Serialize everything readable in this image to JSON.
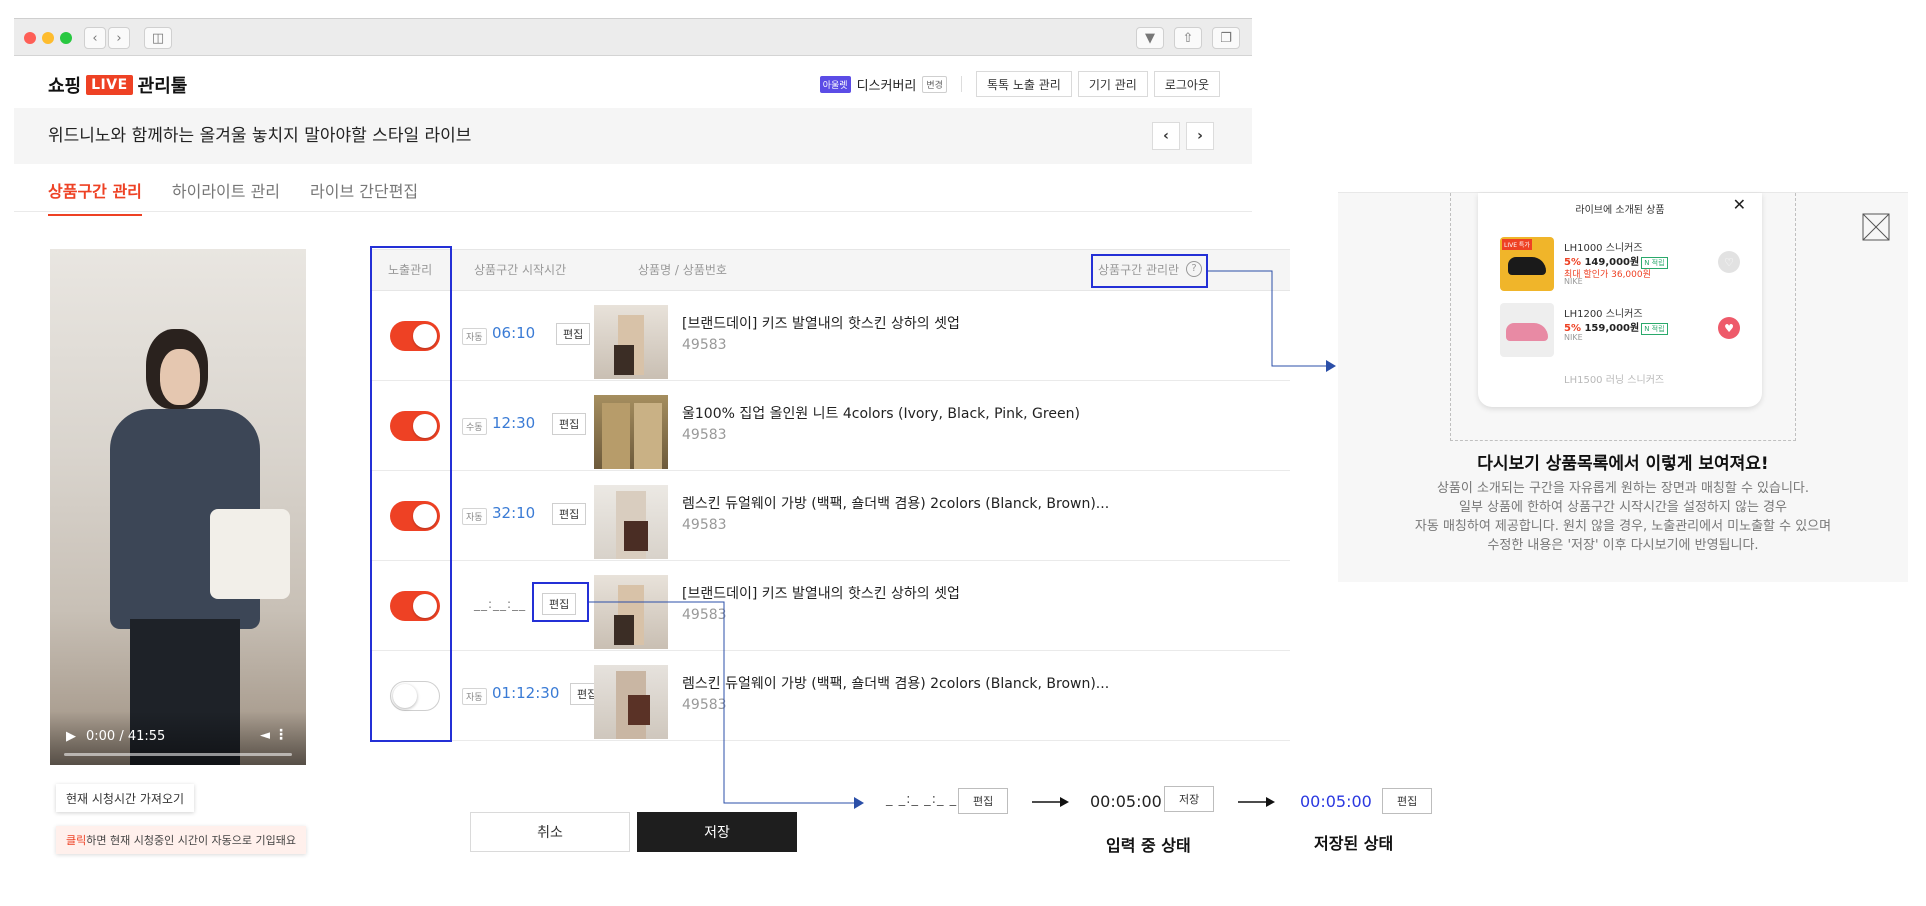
{
  "header": {
    "logo_text": "쇼핑",
    "logo_live": "LIVE",
    "logo_suffix": "관리툴",
    "app_tag": "아울렛",
    "account_name": "디스커버리",
    "change_label": "변경",
    "nav_buttons": [
      "톡톡 노출 관리",
      "기기 관리",
      "로그아웃"
    ]
  },
  "live_title": "위드니노와 함께하는 올겨울 놓치지 말아야할 스타일 라이브",
  "tabs": [
    {
      "label": "상품구간 관리",
      "active": true
    },
    {
      "label": "하이라이트 관리",
      "active": false
    },
    {
      "label": "라이브 간단편집",
      "active": false
    }
  ],
  "video": {
    "time": "0:00 / 41:55",
    "fetch_current_time_label": "현재 시청시간 가져오기",
    "tooltip_highlight": "클릭",
    "tooltip_text": "하면 현재 시청중인 시간이 자동으로 기입돼요"
  },
  "table": {
    "headers": {
      "exposure": "노출관리",
      "start_time": "상품구간 시작시간",
      "product": "상품명 / 상품번호",
      "management": "상품구간 관리란"
    },
    "rows": [
      {
        "exposed": true,
        "mode": "자동",
        "time": "06:10",
        "edit": "편집",
        "name": "[브랜드데이] 키즈 발열내의 핫스킨 상하의 셋업",
        "number": "49583"
      },
      {
        "exposed": true,
        "mode": "수동",
        "time": "12:30",
        "edit": "편집",
        "name": "울100% 집업 올인원 니트 4colors (Ivory, Black, Pink, Green)",
        "number": "49583"
      },
      {
        "exposed": true,
        "mode": "자동",
        "time": "32:10",
        "edit": "편집",
        "name": "렘스킨 듀얼웨이 가방 (백팩, 숄더백 겸용) 2colors (Blanck, Brown)...",
        "number": "49583"
      },
      {
        "exposed": true,
        "mode": "",
        "time": "__:__:__",
        "edit": "편집",
        "name": "[브랜드데이] 키즈 발열내의 핫스킨 상하의 셋업",
        "number": "49583"
      },
      {
        "exposed": false,
        "mode": "자동",
        "time": "01:12:30",
        "edit": "편집",
        "name": "렘스킨 듀얼웨이 가방 (백팩, 숄더백 겸용) 2colors (Blanck, Brown)...",
        "number": "49583"
      }
    ]
  },
  "actions": {
    "cancel": "취소",
    "save": "저장"
  },
  "preview_panel": {
    "popup_title": "라이브에 소개된 상품",
    "items": [
      {
        "live_tag": "LIVE 특가",
        "title": "LH1000 스니커즈",
        "discount": "5%",
        "price": "149,000원",
        "badge": "N 적립",
        "sub": "최대 할인가 36,000원",
        "brand": "NIKE"
      },
      {
        "live_tag": "",
        "title": "LH1200 스니커즈",
        "discount": "5%",
        "price": "159,000원",
        "badge": "N 적립",
        "sub": "",
        "brand": "NIKE"
      },
      {
        "live_tag": "",
        "title": "LH1500 러닝 스니커즈",
        "discount": "",
        "price": "",
        "badge": "",
        "sub": "",
        "brand": ""
      }
    ],
    "heading": "다시보기 상품목록에서 이렇게 보여져요!",
    "description": [
      "상품이 소개되는 구간을 자유롭게 원하는 장면과 매칭할 수 있습니다.",
      "일부 상품에 한하여 상품구간 시작시간을 설정하지 않는 경우",
      "자동 매칭하여 제공합니다. 원치 않을 경우, 노출관리에서 미노출할 수 있으며",
      "수정한 내용은 '저장' 이후 다시보기에 반영됩니다."
    ]
  },
  "flow": {
    "step1_time": "_ _:_ _:_ _",
    "step1_button": "편집",
    "step2_time": "00:05:00",
    "step2_button": "저장",
    "step2_caption": "입력 중 상태",
    "step3_time": "00:05:00",
    "step3_button": "편집",
    "step3_caption": "저장된 상태"
  },
  "colors": {
    "accent": "#ee4124",
    "annotation_blue": "#2430d6",
    "time_blue": "#3a7bd5",
    "save_dark": "#1e1e1e"
  }
}
